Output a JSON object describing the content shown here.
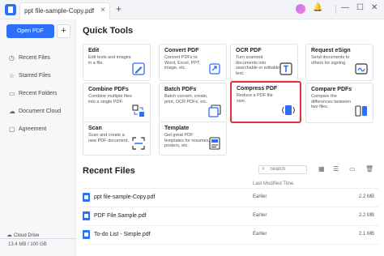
{
  "titlebar": {
    "tab_title": "ppt file-sample-Copy.pdf",
    "tab_close": "×",
    "tab_add": "+",
    "icons": [
      "user-avatar",
      "notification-icon",
      "minimize-icon",
      "maximize-icon",
      "close-icon"
    ]
  },
  "sidebar": {
    "open_pdf": "Open PDF",
    "plus": "+",
    "items": [
      {
        "label": "Recent Files",
        "icon": "clock-icon"
      },
      {
        "label": "Starred Files",
        "icon": "star-icon"
      },
      {
        "label": "Recent Folders",
        "icon": "folder-icon"
      },
      {
        "label": "Document Cloud",
        "icon": "cloud-icon"
      },
      {
        "label": "Agreement",
        "icon": "agreement-icon"
      }
    ],
    "cloud_drive": "Cloud Drive",
    "storage": "13.4 MB / 100 GB"
  },
  "quick_tools": {
    "title": "Quick Tools",
    "cards": [
      {
        "title": "Edit",
        "desc": "Edit texts and images in a file."
      },
      {
        "title": "Convert PDF",
        "desc": "Convert PDFs to Word, Excel, PPT, image, etc."
      },
      {
        "title": "OCR PDF",
        "desc": "Turn scanned documents into searchable or editable text."
      },
      {
        "title": "Request eSign",
        "desc": "Send documents to others for signing."
      },
      {
        "title": "Combine PDFs",
        "desc": "Combine multiple files into a single PDF."
      },
      {
        "title": "Batch PDFs",
        "desc": "Batch convert, create, print, OCR PDFs, etc."
      },
      {
        "title": "Compress PDF",
        "desc": "Reduce a PDF file size."
      },
      {
        "title": "Compare PDFs",
        "desc": "Compare the differences between two files."
      },
      {
        "title": "Scan",
        "desc": "Scan and create a new PDF document."
      },
      {
        "title": "Template",
        "desc": "Get great PDF templates for resumes, posters, etc."
      }
    ]
  },
  "recent": {
    "title": "Recent Files",
    "search_placeholder": "Search",
    "col_modified": "Last Modified Time",
    "files": [
      {
        "name": "ppt file-sample-Copy.pdf",
        "modified": "Earlier",
        "size": "2.2 MB"
      },
      {
        "name": "PDF File Sample.pdf",
        "modified": "Earlier",
        "size": "2.2 MB"
      },
      {
        "name": "To-do List - Simple.pdf",
        "modified": "Earlier",
        "size": "2.1 MB"
      }
    ]
  },
  "colors": {
    "accent": "#2d6ff6",
    "highlight": "#e0323a"
  }
}
